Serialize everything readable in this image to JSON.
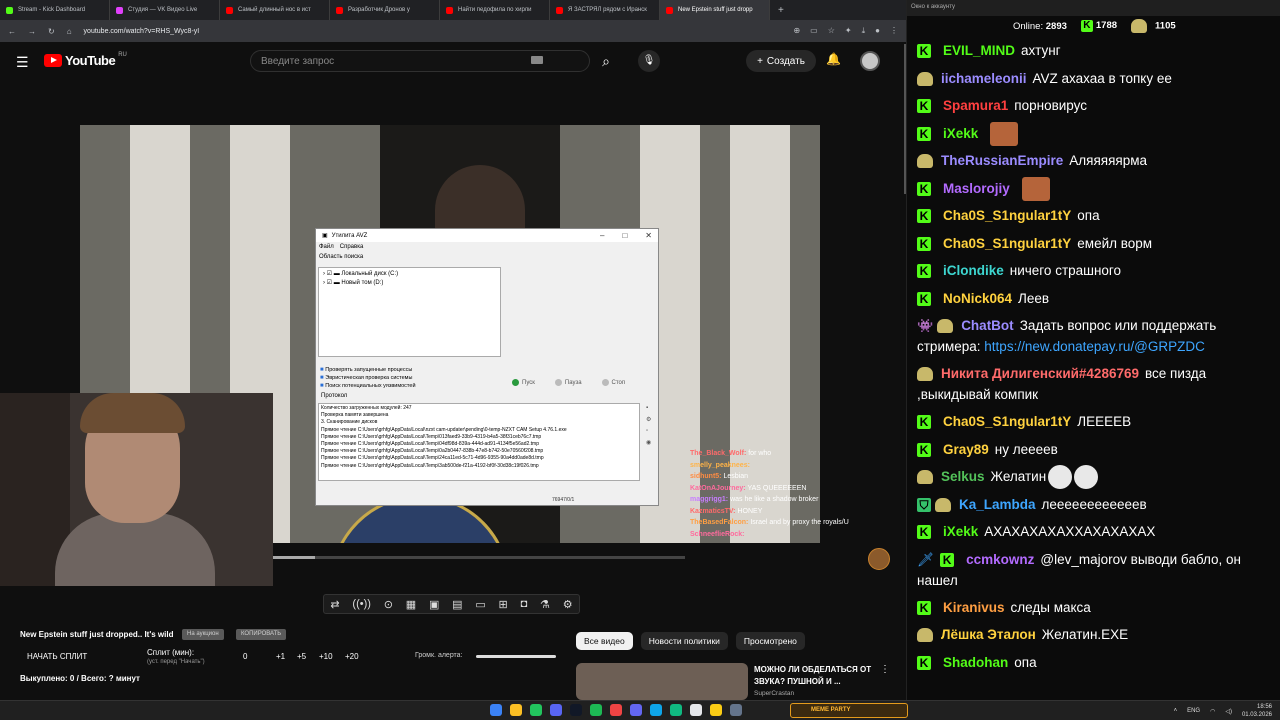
{
  "tabs": [
    {
      "label": "Stream - Kick Dashboard",
      "color": "#53fc18"
    },
    {
      "label": "Студия — VK Видео Live",
      "color": "#e040fb"
    },
    {
      "label": "Самый длинный нос в ист",
      "color": "#ff0000"
    },
    {
      "label": "Разработчик Дронов у",
      "color": "#ff0000"
    },
    {
      "label": "Найти педофила по хирли",
      "color": "#ff0000"
    },
    {
      "label": "Я ЗАСТРЯЛ рядом с Иранск",
      "color": "#ff0000"
    },
    {
      "label": "New Epstein stuff just dropp",
      "color": "#ff0000",
      "active": true
    }
  ],
  "url": "youtube.com/watch?v=RHS_Wyc8-yI",
  "youtube": {
    "logo_text": "YouTube",
    "region": "RU",
    "search_placeholder": "Введите запрос",
    "create_label": "Создать"
  },
  "avz": {
    "title": "Утилита AVZ",
    "menu": [
      "Файл",
      "Справка"
    ],
    "area_label": "Область поиска",
    "drives": [
      "Локальный диск (C:)",
      "Новый том (D:)"
    ],
    "checks": [
      "Проверять запущенные процессы",
      "Эвристическая проверка системы",
      "Поиск потенциальных уязвимостей"
    ],
    "buttons": [
      "Пуск",
      "Пауза",
      "Стоп"
    ],
    "protocol_label": "Протокол",
    "log": [
      "Количество загруженных модулей: 247",
      "Проверка памяти завершена",
      "3. Сканирование дисков",
      "Прямое чтение C:\\Users\\grhfg\\AppData\\Local\\nzxt cam-updater\\pending\\0-temp-NZXT CAM Setup 4.76.1.exe",
      "Прямое чтение C:\\Users\\grhfg\\AppData\\Local\\Temp\\013faed9-33b9-4319-b4a5-38f31ceb76c7.tmp",
      "Прямое чтение C:\\Users\\grhfg\\AppData\\Local\\Temp\\04df98d-839a-444d-ad91-4134f5e56ad2.tmp",
      "Прямое чтение C:\\Users\\grhfg\\AppData\\Local\\Temp\\0a2b0447-838b-47e8-b742-50e70560f208.tmp",
      "Прямое чтение C:\\Users\\grhfg\\AppData\\Local\\Temp\\24ca11ed-5c71-4d96-9355-90a4dd0ade8d.tmp",
      "Прямое чтение C:\\Users\\grhfg\\AppData\\Local\\Temp\\3ab500de-f21a-4192-bf0f-30d38c19f026.tmp"
    ],
    "status": "76947/0/1"
  },
  "overlay_chat": [
    {
      "name": "The_Black_Wolf:",
      "text": "for who",
      "color": "#ff6b6b"
    },
    {
      "name": "smelly_peaknees:",
      "text": "",
      "color": "#ffb347"
    },
    {
      "name": "sidhunt5:",
      "text": "Lesbian",
      "color": "#ff8c42"
    },
    {
      "name": "KatOnAJourney:",
      "text": "YAS QUEEEEEEN",
      "color": "#ff6b9d"
    },
    {
      "name": "maggrigg1:",
      "text": "was he like a shadow broker",
      "color": "#c77dff"
    },
    {
      "name": "KazmaticsTV:",
      "text": "HONEY",
      "color": "#ff6b6b"
    },
    {
      "name": "TheBasedFalcon:",
      "text": "Israel and by proxy the royals/U",
      "color": "#ff9f43"
    },
    {
      "name": "SchneeflieRock:",
      "text": "",
      "color": "#ff6b9d"
    }
  ],
  "split": {
    "title": "New Epstein stuff just dropped.. It's wild",
    "pill1": "На аукцион",
    "pill2": "КОПИРОВАТЬ",
    "start_label": "НАЧАТЬ СПЛИТ",
    "split_label": "Сплит (мин):",
    "split_sub": "(уст. перед \"Начать\")",
    "nums": [
      "0",
      "+1",
      "+5",
      "+10",
      "+20"
    ],
    "alert_label": "Громк. алерта:",
    "bought": "Выкуплено: 0 / Всего: ? минут"
  },
  "related": {
    "chips": [
      "Все видео",
      "Новости политики",
      "Просмотрено"
    ],
    "title": "МОЖНО ЛИ ОБДЕЛАТЬСЯ ОТ ЗВУКА? ПУШНОЙ И ...",
    "channel": "SuperCrastan"
  },
  "taskbar": {
    "meme_label": "MEME PARTY",
    "lang": "ENG",
    "time": "18:56",
    "date": "01.03.2026"
  },
  "chat": {
    "window_title": "Окно к аккаунту",
    "online_label": "Online:",
    "online_count": "2893",
    "kick_count": "1788",
    "vk_count": "1105",
    "messages": [
      {
        "badge": "kick",
        "user": "EVIL_MIND",
        "color": "#53fc18",
        "text": "ахтунг"
      },
      {
        "badge": "pepe",
        "user": "iichameleonii",
        "color": "#9b8cff",
        "text": "AVZ ахахаа в топку ее"
      },
      {
        "badge": "kick",
        "user": "Spamura1",
        "color": "#ff4040",
        "text": "порновирус"
      },
      {
        "badge": "kick",
        "user": "iXekk",
        "color": "#53fc18",
        "text": "",
        "emote": true
      },
      {
        "badge": "pepe",
        "user": "TheRussianEmpire",
        "color": "#9b8cff",
        "text": "Аляяяяярма"
      },
      {
        "badge": "kick",
        "user": "Maslorojiy",
        "color": "#b36bff",
        "text": "",
        "emote": true
      },
      {
        "badge": "kick",
        "user": "Cha0S_S1ngular1tY",
        "color": "#ffd23f",
        "text": "опа"
      },
      {
        "badge": "kick",
        "user": "Cha0S_S1ngular1tY",
        "color": "#ffd23f",
        "text": "емейл ворм"
      },
      {
        "badge": "kick",
        "user": "iClondike",
        "color": "#3dd6d0",
        "text": "ничего страшного"
      },
      {
        "badge": "kick",
        "user": "NoNick064",
        "color": "#ffd23f",
        "text": "Леев"
      },
      {
        "badge": "bot",
        "user": "ChatBot",
        "color": "#9b8cff",
        "text": "Задать вопрос или поддержать стримера: ",
        "link": "https://new.donatepay.ru/@GRPZDC",
        "multi": true
      },
      {
        "badge": "pepe",
        "user": "Никита Дилигенский#4286769",
        "color": "#ff6b6b",
        "text": "все пизда ,выкидывай компик",
        "multi": true
      },
      {
        "badge": "kick",
        "user": "Cha0S_S1ngular1tY",
        "color": "#ffd23f",
        "text": "ЛЕЕЕЕВ"
      },
      {
        "badge": "kick",
        "user": "Gray89",
        "color": "#ffd23f",
        "text": "ну леееев"
      },
      {
        "badge": "pepe",
        "user": "Selkus",
        "color": "#53c25a",
        "text": "Желатин",
        "emote2": true
      },
      {
        "badge": "shield",
        "user": "Ka_Lambda",
        "color": "#3ea6ff",
        "text": "леееееееееееев"
      },
      {
        "badge": "kick",
        "user": "iXekk",
        "color": "#53fc18",
        "text": "АХАХАХАХАХХАХАХАХАХ"
      },
      {
        "badge": "sword",
        "user": "ccmkownz",
        "color": "#b36bff",
        "text": "@lev_majorov выводи бабло, он нашел",
        "multi": true
      },
      {
        "badge": "kick",
        "user": "Kiranivus",
        "color": "#ff9f43",
        "text": "следы макса"
      },
      {
        "badge": "pepe",
        "user": "Лёшка Эталон",
        "color": "#ffd23f",
        "text": "Желатин.EXE"
      },
      {
        "badge": "kick",
        "user": "Shadohan",
        "color": "#53fc18",
        "text": "опа"
      }
    ]
  }
}
